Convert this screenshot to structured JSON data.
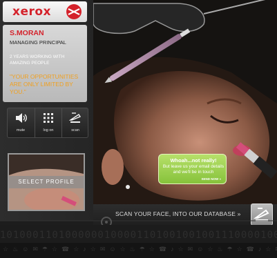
{
  "brand": {
    "name": "xerox",
    "accent": "#d4222b"
  },
  "profile": {
    "name": "S.MORAN",
    "title": "MANAGING PRINCIPAL",
    "years": "2 YEARS WORKING WITH AMAZING PEOPLE",
    "quote": "\"YOUR OPPORTUNITIES ARE ONLY LIMITED BY YOU.\"",
    "quote_color": "#f0a020"
  },
  "controls": [
    {
      "label": "mute",
      "icon": "speaker-icon"
    },
    {
      "label": "log on",
      "icon": "keypad-icon"
    },
    {
      "label": "scan",
      "icon": "scanner-icon"
    }
  ],
  "select_profile": {
    "label": "SELECT PROFILE"
  },
  "bubble": {
    "title": "Whoah...not really!",
    "text": "But leave us your email details and we'll be in touch",
    "send_label": "SEND NOW »",
    "color": "#86c23b"
  },
  "scan_bar": {
    "text": "SCAN YOUR FACE, INTO OUR DATABASE »"
  },
  "footer": {
    "bits": "1010001101000000100001101001001001110000100000",
    "icons": "☆♨☺✉☂☆☎☆♪☆✉☺☆♨☂☆☎♪☆✉☺☆♨☂☆☎♪☆✉☺"
  }
}
